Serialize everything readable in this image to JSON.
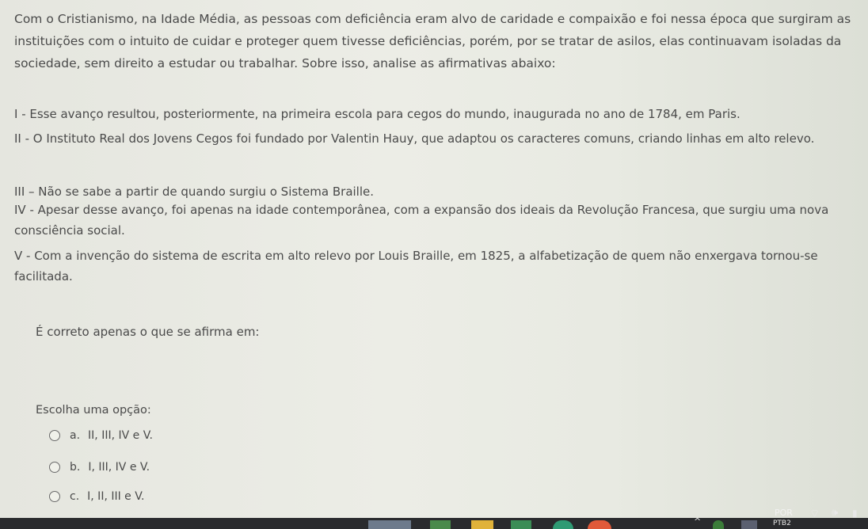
{
  "intro": "Com o Cristianismo, na Idade Média, as pessoas com deficiência eram alvo de caridade e compaixão e foi nessa época que surgiram as instituições com o intuito de cuidar e proteger quem tivesse deficiências, porém, por se tratar de asilos, elas continuavam isoladas da sociedade, sem direito a estudar ou trabalhar. Sobre isso, analise as afirmativas abaixo:",
  "statements": [
    "I - Esse avanço resultou, posteriormente, na primeira escola para cegos do mundo, inaugurada no ano de 1784, em Paris.",
    "II - O Instituto Real dos Jovens Cegos foi fundado por Valentin Hauy, que adaptou os caracteres comuns, criando linhas em alto relevo.",
    "III – Não se sabe a partir de quando surgiu o Sistema Braille.",
    "IV - Apesar desse avanço, foi apenas na idade contemporânea, com a expansão dos ideais da Revolução Francesa, que surgiu uma nova consciência social.",
    "V - Com a invenção do sistema de escrita em alto relevo por Louis Braille, em 1825, a alfabetização de quem não enxergava tornou-se facilitada."
  ],
  "question": "É correto apenas o que se afirma em:",
  "choose_label": "Escolha uma opção:",
  "options": [
    {
      "letter": "a.",
      "text": "II, III, IV e V."
    },
    {
      "letter": "b.",
      "text": "I, III, IV e V."
    },
    {
      "letter": "c.",
      "text": "I, II, III e V."
    }
  ],
  "taskbar": {
    "language": "POR",
    "language_sub": "PTB2"
  },
  "colors": {
    "text": "#4a4a4a",
    "taskbar": "#2a2b2e"
  }
}
